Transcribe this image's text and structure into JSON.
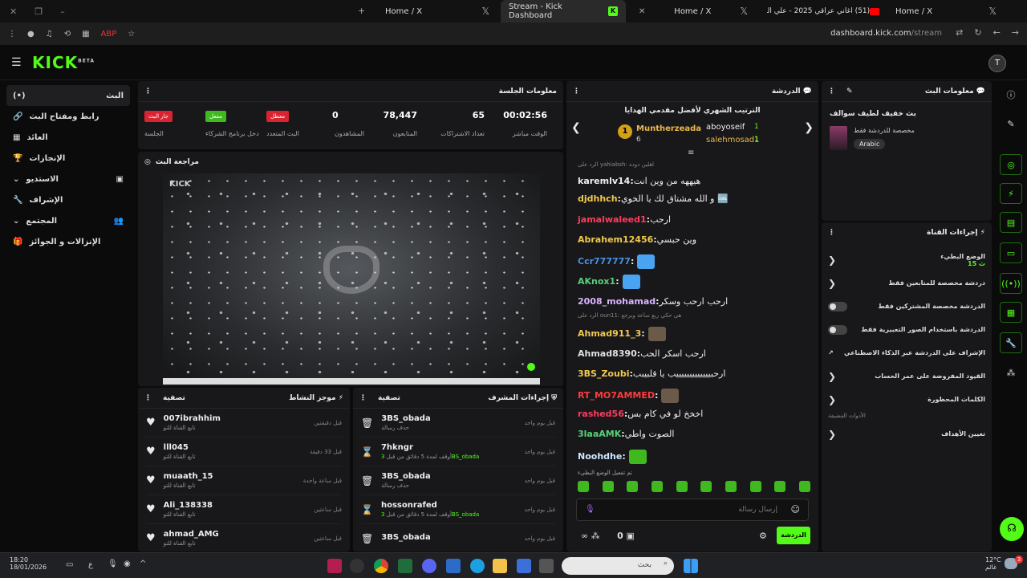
{
  "browser": {
    "tabs": [
      {
        "title": "Home / X"
      },
      {
        "title": "Stream - Kick Dashboard"
      },
      {
        "title": "Home / X"
      },
      {
        "title": "(51) اغاني عراقي 2025 - علي الد"
      },
      {
        "title": "Home / X"
      }
    ],
    "url_host": "dashboard.kick.com",
    "url_path": "/stream"
  },
  "header": {
    "logo": "KICK",
    "logo_badge": "BETA",
    "avatar_initial": "T"
  },
  "sidebar": {
    "items": [
      {
        "label": "البث",
        "icon": "broadcast-icon"
      },
      {
        "label": "رابط ومفتاح البث",
        "icon": "link-icon"
      },
      {
        "label": "العائد",
        "icon": "chart-icon"
      },
      {
        "label": "الإنجازات",
        "icon": "trophy-icon"
      },
      {
        "label": "الاستديو",
        "icon": "studio-icon"
      },
      {
        "label": "الإشراف",
        "icon": "wrench-icon"
      },
      {
        "label": "المجتمع",
        "icon": "community-icon"
      },
      {
        "label": "الإنزالات و الجوائز",
        "icon": "gift-icon"
      }
    ]
  },
  "session": {
    "title": "معلومات الجلسة",
    "stats": [
      {
        "value": "00:02:56",
        "label": "الوقت مباشر"
      },
      {
        "value": "65",
        "label": "تعداد الاشتراكات"
      },
      {
        "value": "78,447",
        "label": "المتابعون"
      },
      {
        "value": "0",
        "label": "المشاهدون"
      }
    ],
    "tags": [
      {
        "badge": "معطل",
        "label": "البث المتعدد",
        "color": "#d9232e"
      },
      {
        "badge": "مفعل",
        "label": "دخل برنامج الشركاء",
        "color": "#3fb91d"
      },
      {
        "badge": "جار البث",
        "label": "الجلسة",
        "color": "#d9232e"
      }
    ]
  },
  "preview": {
    "title": "مراجعة البث"
  },
  "activity": {
    "title": "موجز النشاط",
    "filter": "تصفية",
    "items": [
      {
        "name": "007ibrahhim",
        "sub": "تابع القناة للتو",
        "time": "قبل دقيقتين"
      },
      {
        "name": "lll045",
        "sub": "تابع القناة للتو",
        "time": "قبل 33 دقيقة"
      },
      {
        "name": "muaath_15",
        "sub": "تابع القناة للتو",
        "time": "قبل ساعة واحدة"
      },
      {
        "name": "Ali_138338",
        "sub": "تابع القناة للتو",
        "time": "قبل ساعتين"
      },
      {
        "name": "ahmad_AMG",
        "sub": "تابع القناة للتو",
        "time": "قبل ساعتين"
      }
    ]
  },
  "modactions": {
    "title": "إجراءات المشرف",
    "filter": "تصفية",
    "items": [
      {
        "name": "3BS_obada",
        "sub": "حذف رسالة",
        "time": "قبل يوم واحد",
        "icon": "trash-icon"
      },
      {
        "name": "7hkngr",
        "sub": "أوقف لمدة 5 دقائق من قبل",
        "mod": "3BS_obada",
        "time": "قبل يوم واحد",
        "icon": "hourglass-icon"
      },
      {
        "name": "3BS_obada",
        "sub": "حذف رسالة",
        "time": "قبل يوم واحد",
        "icon": "trash-icon"
      },
      {
        "name": "hossonrafed",
        "sub": "أوقف لمدة 5 دقائق من قبل",
        "mod": "3BS_obada",
        "time": "قبل يوم واحد",
        "icon": "hourglass-icon"
      },
      {
        "name": "3BS_obada",
        "sub": "",
        "time": "قبل يوم واحد",
        "icon": "trash-icon"
      }
    ]
  },
  "chat": {
    "title": "الدردشة",
    "leaderboard_title": "الترتيب الشهري لأفضل مقدمي الهدايا",
    "leaders": [
      {
        "rank": "1",
        "name": "Muntherzeada",
        "count": "6"
      },
      {
        "name": "aboyoseif",
        "count": "1"
      },
      {
        "name": "salehmosad1",
        "count": "1"
      }
    ],
    "messages": [
      {
        "reply": "الرد على yahiabsh: اهلين دوده",
        "user": "karemlv14",
        "text": "هيههه من وين انت",
        "color": "#f0f0f0"
      },
      {
        "user": "djdhhch",
        "text": "و الله مشتاق لك يا الخوي 🆒",
        "color": "#f2c94c"
      },
      {
        "user": "jamalwaleed1",
        "text": "ارحب",
        "color": "#ff3b5c"
      },
      {
        "user": "Abrahem12456",
        "text": "وين حبسي",
        "color": "#f2c94c"
      },
      {
        "user": "Ccr777777",
        "text": "",
        "color": "#4a90e2"
      },
      {
        "user": "AKnox1",
        "text": "",
        "color": "#5ad07a"
      },
      {
        "user": "2008_mohamad",
        "text": "ارحب ارحب وسكر",
        "color": "#d9b3ff"
      },
      {
        "reply": "الرد على oun11: هي حكي ربع ساعة ويرجع",
        "user": "Ahmad911_3",
        "text": "",
        "color": "#f2c94c"
      },
      {
        "user": "Ahmad8390",
        "text": "ارحب اسكر الحب",
        "color": "#e0e0e0"
      },
      {
        "user": "3BS_Zoubi",
        "text": "ارحبيييييييييييييب يا قلبيبب",
        "color": "#f2c94c"
      },
      {
        "user": "RT_MO7AMMED",
        "text": "",
        "color": "#ff3b3b"
      },
      {
        "user": "rashed56",
        "text": "اخخخ لو في كام بس",
        "color": "#ff3b5c"
      },
      {
        "user": "3laaAMK",
        "text": "الصوت واطي",
        "color": "#5ad07a"
      },
      {
        "user": "Noohdhe",
        "text": "",
        "color": "#cfe8ff"
      }
    ],
    "slow_mode_note": "تم تفعيل الوضع البطيء",
    "input_placeholder": "إرسال رسالة",
    "send_label": "الدردشة",
    "points": "0"
  },
  "streaminfo": {
    "title": "معلومات البث",
    "stream_title": "بث خفيف لطيف سوالف",
    "subtitle": "مخصصة للدردشة فقط",
    "category": "Arabic"
  },
  "channelactions": {
    "title": "إجراءات القناة",
    "items": [
      {
        "label": "الوضع البطيء",
        "sub": "15 ث",
        "control": "chevron"
      },
      {
        "label": "دردشة مخصصة للمتابعين فقط",
        "control": "chevron"
      },
      {
        "label": "الدردشة مخصصة المشتركين فقط",
        "control": "toggle"
      },
      {
        "label": "الدردشة باستخدام الصور التعبيرية فقط",
        "control": "toggle"
      },
      {
        "label": "الإشراف على الدردشة عبر الذكاء الاصطناعي",
        "control": "external"
      },
      {
        "label": "القيود المفروضة على عمر الحساب",
        "control": "chevron"
      },
      {
        "label": "الكلمات المحظورة",
        "control": "chevron"
      }
    ],
    "section_label": "الأدوات المضيفة",
    "goals": "تعيين الأهداف"
  },
  "taskbar": {
    "time": "18:20",
    "date": "18/01/2026",
    "search_placeholder": "بحث",
    "weather": "12°C",
    "weather_sub": "غائم",
    "notif": "3",
    "lang": "ع"
  },
  "colors": {
    "accent": "#53fc18",
    "panel": "#18181b",
    "bg": "#0b0b0c"
  }
}
